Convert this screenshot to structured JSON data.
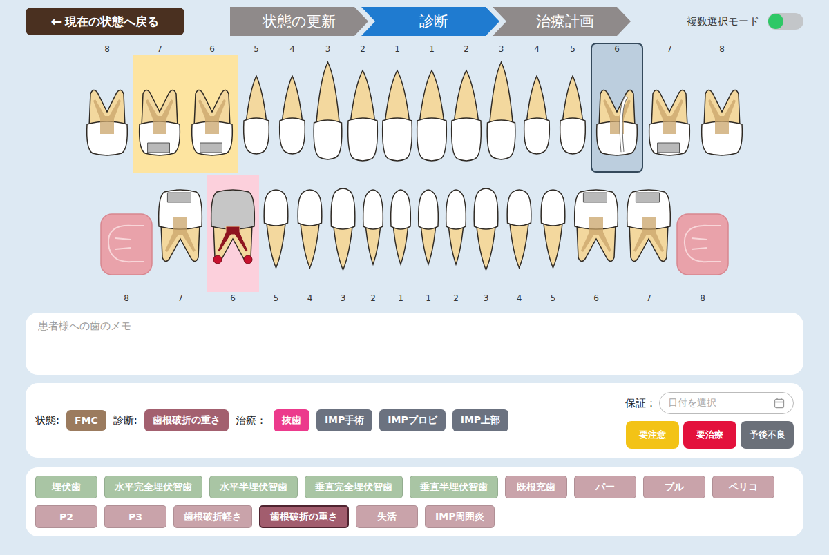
{
  "back_button": {
    "icon": "←",
    "label": "現在の状態へ戻る"
  },
  "steps": [
    {
      "label": "状態の更新",
      "selected": false
    },
    {
      "label": "診断",
      "selected": true
    },
    {
      "label": "治療計画",
      "selected": false
    }
  ],
  "multi_select": {
    "label": "複数選択モード",
    "on": false
  },
  "upper_teeth": [
    {
      "number": "8",
      "kind": "molar",
      "restoration": "none",
      "color": null,
      "selected": false,
      "fracture": false,
      "lesion": false
    },
    {
      "number": "7",
      "kind": "molar",
      "restoration": "inlay",
      "color": "#fde4a0",
      "selected": false,
      "fracture": false,
      "lesion": false
    },
    {
      "number": "6",
      "kind": "molar",
      "restoration": "inlay",
      "color": "#fde4a0",
      "selected": false,
      "fracture": false,
      "lesion": false
    },
    {
      "number": "5",
      "kind": "premolar",
      "restoration": "none",
      "color": null,
      "selected": false,
      "fracture": false,
      "lesion": false
    },
    {
      "number": "4",
      "kind": "premolar",
      "restoration": "none",
      "color": null,
      "selected": false,
      "fracture": false,
      "lesion": false
    },
    {
      "number": "3",
      "kind": "canine",
      "restoration": "none",
      "color": null,
      "selected": false,
      "fracture": false,
      "lesion": false
    },
    {
      "number": "2",
      "kind": "incisor",
      "restoration": "none",
      "color": null,
      "selected": false,
      "fracture": false,
      "lesion": false
    },
    {
      "number": "1",
      "kind": "incisor",
      "restoration": "none",
      "color": null,
      "selected": false,
      "fracture": false,
      "lesion": false
    },
    {
      "number": "1",
      "kind": "incisor",
      "restoration": "none",
      "color": null,
      "selected": false,
      "fracture": false,
      "lesion": false
    },
    {
      "number": "2",
      "kind": "incisor",
      "restoration": "none",
      "color": null,
      "selected": false,
      "fracture": false,
      "lesion": false
    },
    {
      "number": "3",
      "kind": "canine",
      "restoration": "none",
      "color": null,
      "selected": false,
      "fracture": false,
      "lesion": false
    },
    {
      "number": "4",
      "kind": "premolar",
      "restoration": "none",
      "color": null,
      "selected": false,
      "fracture": false,
      "lesion": false
    },
    {
      "number": "5",
      "kind": "premolar",
      "restoration": "none",
      "color": null,
      "selected": false,
      "fracture": false,
      "lesion": false
    },
    {
      "number": "6",
      "kind": "molar",
      "restoration": "none",
      "color": null,
      "selected": true,
      "fracture": true,
      "lesion": false
    },
    {
      "number": "7",
      "kind": "molar",
      "restoration": "inlay",
      "color": null,
      "selected": false,
      "fracture": false,
      "lesion": false
    },
    {
      "number": "8",
      "kind": "molar",
      "restoration": "none",
      "color": null,
      "selected": false,
      "fracture": false,
      "lesion": false
    }
  ],
  "lower_teeth": [
    {
      "number": "8",
      "kind": "impacted",
      "restoration": "none",
      "color": null,
      "selected": false,
      "fracture": false,
      "lesion": false
    },
    {
      "number": "7",
      "kind": "molar",
      "restoration": "inlay",
      "color": null,
      "selected": false,
      "fracture": false,
      "lesion": false
    },
    {
      "number": "6",
      "kind": "molar",
      "restoration": "crown",
      "color": "#fcd0dc",
      "selected": false,
      "fracture": false,
      "lesion": true
    },
    {
      "number": "5",
      "kind": "premolar",
      "restoration": "none",
      "color": null,
      "selected": false,
      "fracture": false,
      "lesion": false
    },
    {
      "number": "4",
      "kind": "premolar",
      "restoration": "none",
      "color": null,
      "selected": false,
      "fracture": false,
      "lesion": false
    },
    {
      "number": "3",
      "kind": "canine",
      "restoration": "none",
      "color": null,
      "selected": false,
      "fracture": false,
      "lesion": false
    },
    {
      "number": "2",
      "kind": "incisor",
      "restoration": "none",
      "color": null,
      "selected": false,
      "fracture": false,
      "lesion": false
    },
    {
      "number": "1",
      "kind": "incisor",
      "restoration": "none",
      "color": null,
      "selected": false,
      "fracture": false,
      "lesion": false
    },
    {
      "number": "1",
      "kind": "incisor",
      "restoration": "none",
      "color": null,
      "selected": false,
      "fracture": false,
      "lesion": false
    },
    {
      "number": "2",
      "kind": "incisor",
      "restoration": "none",
      "color": null,
      "selected": false,
      "fracture": false,
      "lesion": false
    },
    {
      "number": "3",
      "kind": "canine",
      "restoration": "none",
      "color": null,
      "selected": false,
      "fracture": false,
      "lesion": false
    },
    {
      "number": "4",
      "kind": "premolar",
      "restoration": "none",
      "color": null,
      "selected": false,
      "fracture": false,
      "lesion": false
    },
    {
      "number": "5",
      "kind": "premolar",
      "restoration": "none",
      "color": null,
      "selected": false,
      "fracture": false,
      "lesion": false
    },
    {
      "number": "6",
      "kind": "molar",
      "restoration": "inlay",
      "color": null,
      "selected": false,
      "fracture": false,
      "lesion": false
    },
    {
      "number": "7",
      "kind": "molar",
      "restoration": "inlay",
      "color": null,
      "selected": false,
      "fracture": false,
      "lesion": false
    },
    {
      "number": "8",
      "kind": "impacted",
      "restoration": "none",
      "color": null,
      "selected": false,
      "fracture": false,
      "lesion": false
    }
  ],
  "memo": {
    "placeholder": "患者様への歯のメモ"
  },
  "summary": {
    "groups": [
      {
        "label": "状態:",
        "tags": [
          {
            "text": "FMC",
            "color": "#9b7b5e"
          }
        ]
      },
      {
        "label": "診断:",
        "tags": [
          {
            "text": "歯根破折の重さ",
            "color": "#a3606f"
          }
        ]
      },
      {
        "label": "治療：",
        "tags": [
          {
            "text": "抜歯",
            "color": "#ec3a8c"
          },
          {
            "text": "IMP手術",
            "color": "#6b7280"
          },
          {
            "text": "IMPプロビ",
            "color": "#6b7280"
          },
          {
            "text": "IMP上部",
            "color": "#6b7280"
          }
        ]
      }
    ],
    "guarantee": {
      "label": "保証：",
      "placeholder": "日付を選択"
    },
    "flags": [
      {
        "text": "要注意",
        "color": "#f3c316"
      },
      {
        "text": "要治療",
        "color": "#e3113c"
      },
      {
        "text": "予後不良",
        "color": "#6b7079"
      }
    ]
  },
  "diagnoses": [
    {
      "text": "埋伏歯",
      "color": "#a9c5a4",
      "selected": false
    },
    {
      "text": "水平完全埋伏智歯",
      "color": "#a9c5a4",
      "selected": false
    },
    {
      "text": "水平半埋伏智歯",
      "color": "#a9c5a4",
      "selected": false
    },
    {
      "text": "垂直完全埋伏智歯",
      "color": "#a9c5a4",
      "selected": false
    },
    {
      "text": "垂直半埋伏智歯",
      "color": "#a9c5a4",
      "selected": false
    },
    {
      "text": "既根充歯",
      "color": "#c9a3aa",
      "selected": false
    },
    {
      "text": "パー",
      "color": "#c9a3aa",
      "selected": false
    },
    {
      "text": "プル",
      "color": "#c9a3aa",
      "selected": false
    },
    {
      "text": "ペリコ",
      "color": "#c9a3aa",
      "selected": false
    },
    {
      "text": "P2",
      "color": "#c9a3aa",
      "selected": false
    },
    {
      "text": "P3",
      "color": "#c9a3aa",
      "selected": false
    },
    {
      "text": "歯根破折軽さ",
      "color": "#c9a3aa",
      "selected": false
    },
    {
      "text": "歯根破折の重さ",
      "color": "#c9a3aa",
      "selected": true
    },
    {
      "text": "失活",
      "color": "#c9a3aa",
      "selected": false
    },
    {
      "text": "IMP周囲炎",
      "color": "#c9a3aa",
      "selected": false
    }
  ]
}
